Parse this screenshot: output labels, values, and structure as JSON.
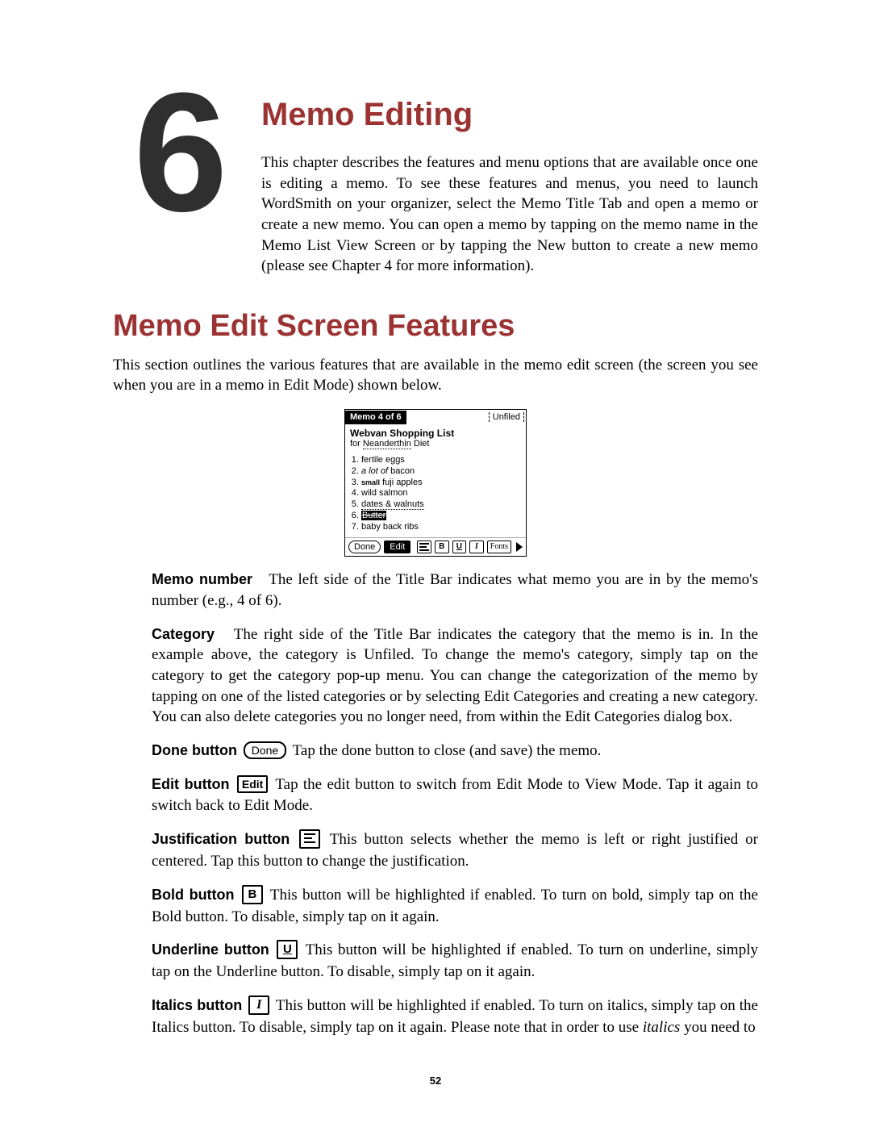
{
  "chapter": {
    "number": "6",
    "title": "Memo Editing",
    "intro": "This chapter describes the features and menu options that are available once one is editing a memo.  To see these features and menus, you need to launch WordSmith on your organizer, select the Memo Title Tab and open a memo or create a new memo.  You can open a memo by tapping on the memo name in the Memo List View Screen or by tapping the New button to create a new memo (please see Chapter 4 for more information)."
  },
  "section": {
    "heading": "Memo Edit Screen Features",
    "lead": "This section outlines the various features that are available in the memo edit screen (the screen you see when you are in a memo in Edit Mode) shown below."
  },
  "screenshot": {
    "tab": "Memo 4 of 6",
    "category": "Unfiled",
    "memo_title": "Webvan Shopping List",
    "subtitle_prefix": "for ",
    "subtitle_dotted": "Neanderthin",
    "subtitle_suffix": " Diet",
    "items": [
      {
        "text": "fertile  eggs"
      },
      {
        "italic": "a lot of",
        "rest": " bacon"
      },
      {
        "small": "small",
        "rest": " fuji apples"
      },
      {
        "text": " wild salmon"
      },
      {
        "text": " dates & walnuts",
        "underline": true
      },
      {
        "highlight": "Butter"
      },
      {
        "text": "baby back ribs"
      }
    ],
    "done": "Done",
    "edit": "Edit",
    "fonts": "Fonts"
  },
  "features": {
    "memo_number": {
      "label": "Memo number",
      "text": "The left side of the Title Bar indicates what memo you are in by the memo's number (e.g., 4 of 6)."
    },
    "category": {
      "label": "Category",
      "text": "The right side of the Title Bar indicates the category that the memo is in.  In the example above, the category is Unfiled. To change the memo's category, simply tap on the category to get the category pop-up menu.  You can change the categorization of the memo by tapping on one of the listed categories or by selecting Edit Categories and creating a new category.  You can also delete categories you no longer need, from within the Edit Categories dialog box."
    },
    "done": {
      "label": "Done button",
      "icon_text": "Done",
      "text": "Tap the done button to close (and save) the memo."
    },
    "edit": {
      "label": "Edit button",
      "icon_text": "Edit",
      "text": "Tap the edit button to switch from Edit Mode to View Mode.  Tap it again to switch back to Edit Mode."
    },
    "justify": {
      "label": "Justification button",
      "text": "This button selects whether the memo is left or right justified or centered.  Tap this button to change the justification."
    },
    "bold": {
      "label": "Bold button",
      "glyph": "B",
      "text": "This button will be highlighted if enabled.  To turn on bold, simply tap on the Bold button.  To disable, simply tap on it again."
    },
    "underline": {
      "label": "Underline button",
      "glyph": "U",
      "text": "This button will be highlighted if enabled.  To turn on underline, simply tap on the Underline button.  To disable, simply tap on it again."
    },
    "italics": {
      "label": "Italics button",
      "glyph": "I",
      "text_before": "This button will be highlighted if enabled.  To turn on italics, simply tap on the Italics button.  To disable, simply tap on it again.  Please note that in order to use ",
      "italic_word": "italics",
      "text_after": " you need to"
    }
  },
  "page_number": "52"
}
